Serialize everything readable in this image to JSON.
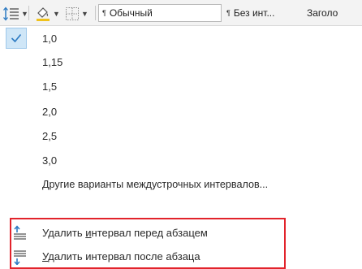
{
  "toolbar": {
    "line_spacing_icon": "line-spacing-icon",
    "shading_icon": "paint-bucket-icon",
    "borders_icon": "borders-icon",
    "styles": [
      {
        "label": "Обычный",
        "active": true
      },
      {
        "label": "Без инт...",
        "active": false
      },
      {
        "label": "Заголо",
        "active": false
      }
    ],
    "paragraph_mark": "¶"
  },
  "menu": {
    "spacing_options": [
      {
        "label": "1,0",
        "checked": true
      },
      {
        "label": "1,15",
        "checked": false
      },
      {
        "label": "1,5",
        "checked": false
      },
      {
        "label": "2,0",
        "checked": false
      },
      {
        "label": "2,5",
        "checked": false
      },
      {
        "label": "3,0",
        "checked": false
      }
    ],
    "more_options": "Другие варианты междустрочных интервалов...",
    "remove_before": {
      "prefix": "Удалить ",
      "underlined": "и",
      "suffix": "нтервал перед абзацем"
    },
    "remove_after": {
      "prefix": "",
      "underlined": "У",
      "suffix": "далить интервал после абзаца"
    }
  },
  "colors": {
    "highlight_border": "#e2232b",
    "check_bg": "#cfe6f7",
    "icon_blue": "#2b79c2"
  }
}
